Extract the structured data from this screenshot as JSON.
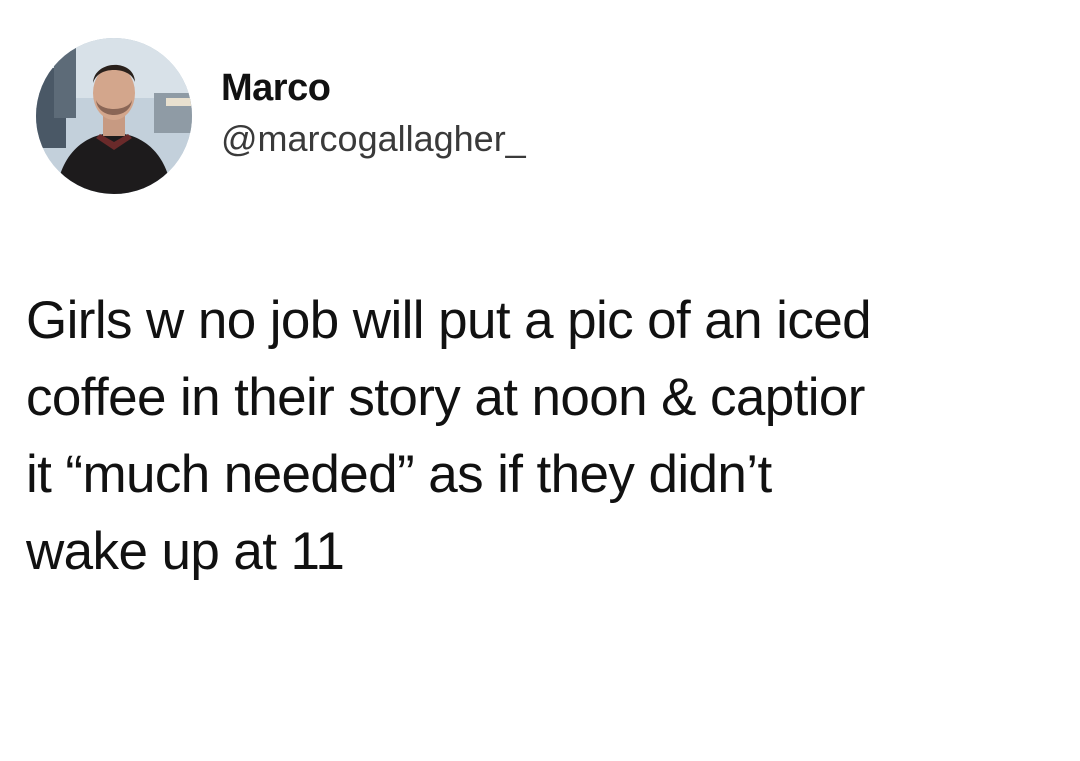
{
  "tweet": {
    "author": {
      "display_name": "Marco",
      "handle": "@marcogallagher_",
      "avatar_icon": "profile-photo"
    },
    "text_lines": [
      "Girls w no job will put a pic of an iced",
      "coffee in their story at noon & captior",
      "it “much needed” as if they didn’t",
      "wake up at 11"
    ]
  }
}
